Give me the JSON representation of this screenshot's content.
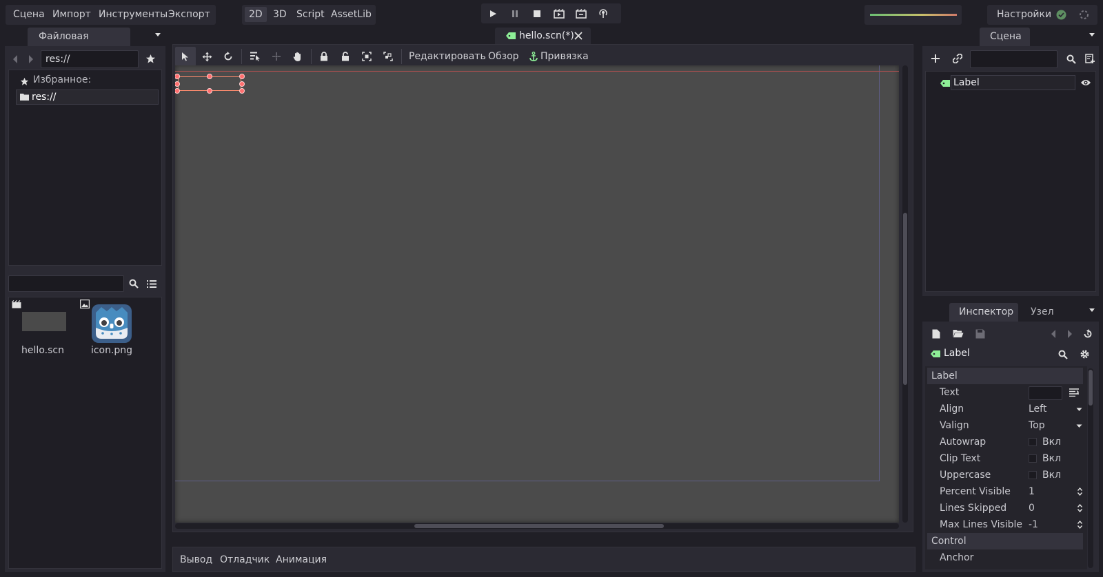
{
  "menu": {
    "scene": "Сцена",
    "import": "Импорт",
    "tools": "Инструменты",
    "export": "Экспорт"
  },
  "modes": [
    "2D",
    "3D",
    "Script",
    "AssetLib"
  ],
  "settings_label": "Настройки",
  "left_dock": {
    "tab": "Файловая система",
    "path": "res://",
    "favorites_label": "Избранное:",
    "tree_root": "res://",
    "files": [
      {
        "name": "hello.scn",
        "type": "scene"
      },
      {
        "name": "icon.png",
        "type": "image"
      }
    ]
  },
  "editor_tab": "hello.scn(*)",
  "toolbar": {
    "edit": "Редактировать",
    "view": "Обзор",
    "snap": "Привязка"
  },
  "bottom_panel": [
    "Вывод",
    "Отладчик",
    "Анимация"
  ],
  "scene_dock": {
    "tab": "Сцена",
    "root_node": "Label"
  },
  "inspector": {
    "tabs": [
      "Инспектор",
      "Узел"
    ],
    "node": "Label",
    "section_label": "Label",
    "properties": [
      {
        "name": "Text",
        "value": ""
      },
      {
        "name": "Align",
        "value": "Left"
      },
      {
        "name": "Valign",
        "value": "Top"
      },
      {
        "name": "Autowrap",
        "value": "Вкл"
      },
      {
        "name": "Clip Text",
        "value": "Вкл"
      },
      {
        "name": "Uppercase",
        "value": "Вкл"
      },
      {
        "name": "Percent Visible",
        "value": "1"
      },
      {
        "name": "Lines Skipped",
        "value": "0"
      },
      {
        "name": "Max Lines Visible",
        "value": "-1"
      }
    ],
    "section_control": "Control",
    "anchor": "Anchor"
  },
  "colors": {
    "accent_green": "#8eef97",
    "selection_red": "#ff7070",
    "viewport": "#4b4b4b"
  }
}
